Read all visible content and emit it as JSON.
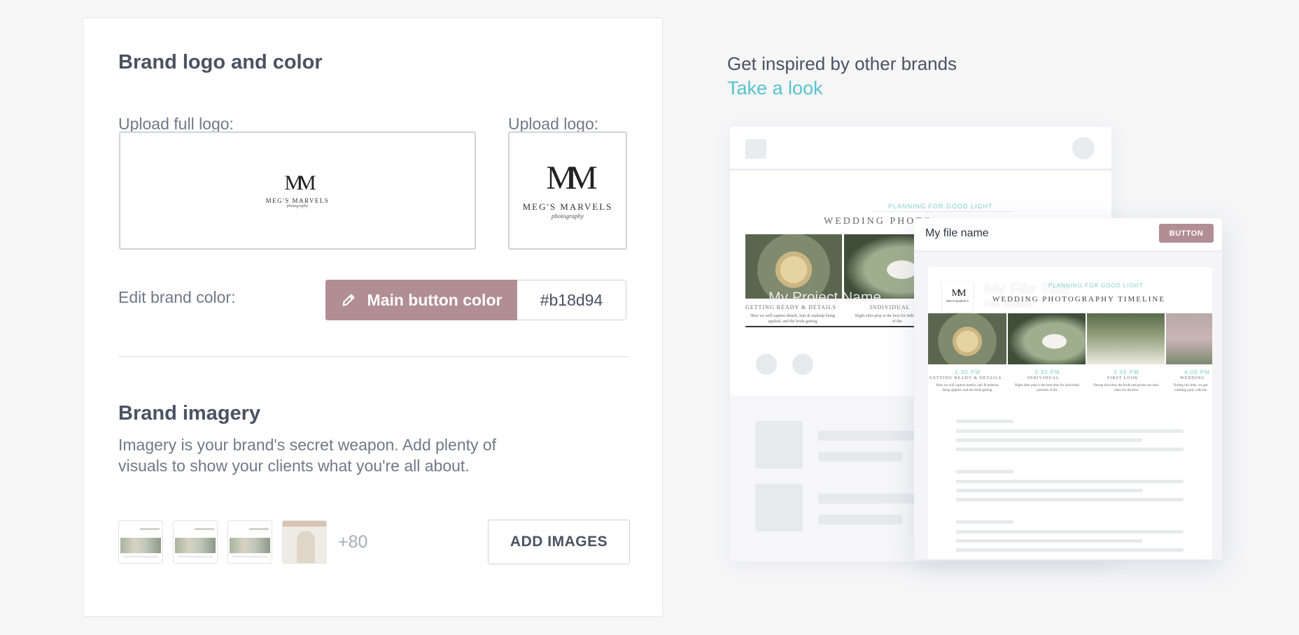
{
  "brand_logo": {
    "title": "Brand logo and color",
    "full_logo_label": "Upload full logo:",
    "logo_label": "Upload logo:",
    "logo_monogram": "MM",
    "logo_name": "MEG'S MARVELS",
    "logo_tagline": "photography"
  },
  "brand_color": {
    "label": "Edit brand color:",
    "button_label": "Main button color",
    "hex_value": "#b18d94",
    "color": "#b18d94"
  },
  "brand_imagery": {
    "title": "Brand imagery",
    "description": "Imagery is your brand's secret weapon. Add plenty of visuals to show your clients what you're all about.",
    "more_count": "+80",
    "add_button": "ADD IMAGES"
  },
  "inspire": {
    "heading": "Get inspired by other brands",
    "link": "Take a look"
  },
  "preview": {
    "planning_text": "PLANNING FOR GOOD LIGHT",
    "timeline_title_short": "WEDDING PHOTO",
    "timeline_title": "WEDDING PHOTOGRAPHY TIMELINE",
    "project_name": "My Project Name",
    "file_name": "My file name",
    "file_title": "My File Title",
    "file_subtitle": "File subtitle",
    "button_label": "BUTTON",
    "back_col1_heading": "GETTING READY & DETAILS",
    "back_col2_heading": "INDIVIDUAL",
    "back_col1_text": "Here we will capture details, hair & makeup being applied, and the bride getting",
    "back_col2_text": "Right after prep is the best for individual portraits of the",
    "times": [
      "1:30 PM",
      "3:30 PM",
      "3:45 PM",
      "4:00 PM"
    ],
    "headings": [
      "GETTING READY & DETAILS",
      "INDIVIDUAL",
      "FIRST LOOK",
      "WEDDING"
    ],
    "texts": [
      "Here we will capture details, hair & makeup being applied, and the bride getting",
      "Right after prep is the best time for individual portraits of the",
      "During this time, the bride and groom are each other for the first",
      "During this time, we get wedding party with the"
    ]
  }
}
